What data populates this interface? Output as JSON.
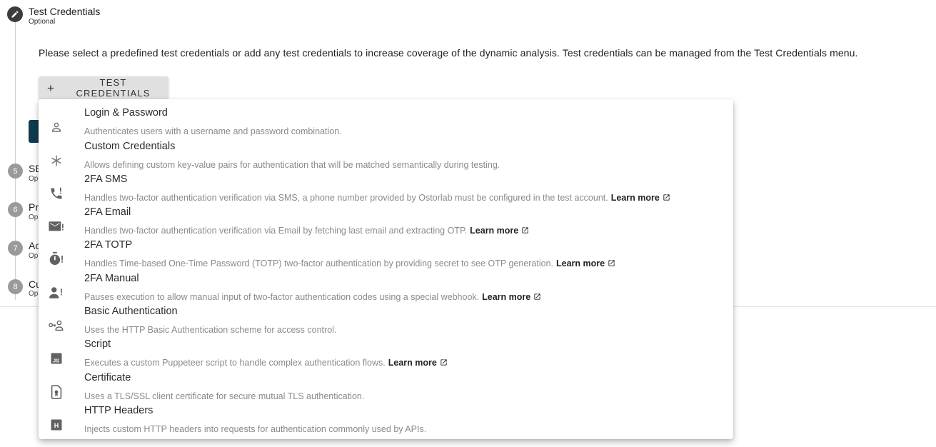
{
  "step": {
    "title": "Test Credentials",
    "subtitle": "Optional"
  },
  "description": "Please select a predefined test credentials or add any test credentials to increase coverage of the dynamic analysis. Test credentials can be managed from the Test Credentials menu.",
  "add_button": {
    "icon": "+",
    "label": "TEST CREDENTIALS"
  },
  "other_steps": [
    {
      "number": "5",
      "title": "SE",
      "subtitle": "Op"
    },
    {
      "number": "6",
      "title": "Pr",
      "subtitle": "Op"
    },
    {
      "number": "7",
      "title": "Ac",
      "subtitle": "Op"
    },
    {
      "number": "8",
      "title": "Cu",
      "subtitle": "Op"
    }
  ],
  "menu": {
    "learn_more_label": "Learn more",
    "items": [
      {
        "icon": "person-icon",
        "title": "Login & Password",
        "description": "Authenticates users with a username and password combination."
      },
      {
        "icon": "asterisk-icon",
        "title": "Custom Credentials",
        "description": "Allows defining custom key-value pairs for authentication that will be matched semantically during testing."
      },
      {
        "icon": "phone-alert-icon",
        "title": "2FA SMS",
        "description": "Handles two-factor authentication verification via SMS, a phone number provided by Ostorlab must be configured in the test account.",
        "learn_more": "Learn more"
      },
      {
        "icon": "mail-alert-icon",
        "title": "2FA Email",
        "description": "Handles two-factor authentication verification via Email by fetching last email and extracting OTP.",
        "learn_more": "Learn more"
      },
      {
        "icon": "timer-alert-icon",
        "title": "2FA TOTP",
        "description": "Handles Time-based One-Time Password (TOTP) two-factor authentication by providing secret to see OTP generation.",
        "learn_more": "Learn more"
      },
      {
        "icon": "person-alert-icon",
        "title": "2FA Manual",
        "description": "Pauses execution to allow manual input of two-factor authentication codes using a special webhook.",
        "learn_more": "Learn more"
      },
      {
        "icon": "key-person-icon",
        "title": "Basic Authentication",
        "description": "Uses the HTTP Basic Authentication scheme for access control."
      },
      {
        "icon": "js-file-icon",
        "title": "Script",
        "description": "Executes a custom Puppeteer script to handle complex authentication flows.",
        "learn_more": "Learn more"
      },
      {
        "icon": "certificate-icon",
        "title": "Certificate",
        "description": "Uses a TLS/SSL client certificate for secure mutual TLS authentication."
      },
      {
        "icon": "http-header-icon",
        "title": "HTTP Headers",
        "description": "Injects custom HTTP headers into requests for authentication commonly used by APIs."
      }
    ]
  }
}
